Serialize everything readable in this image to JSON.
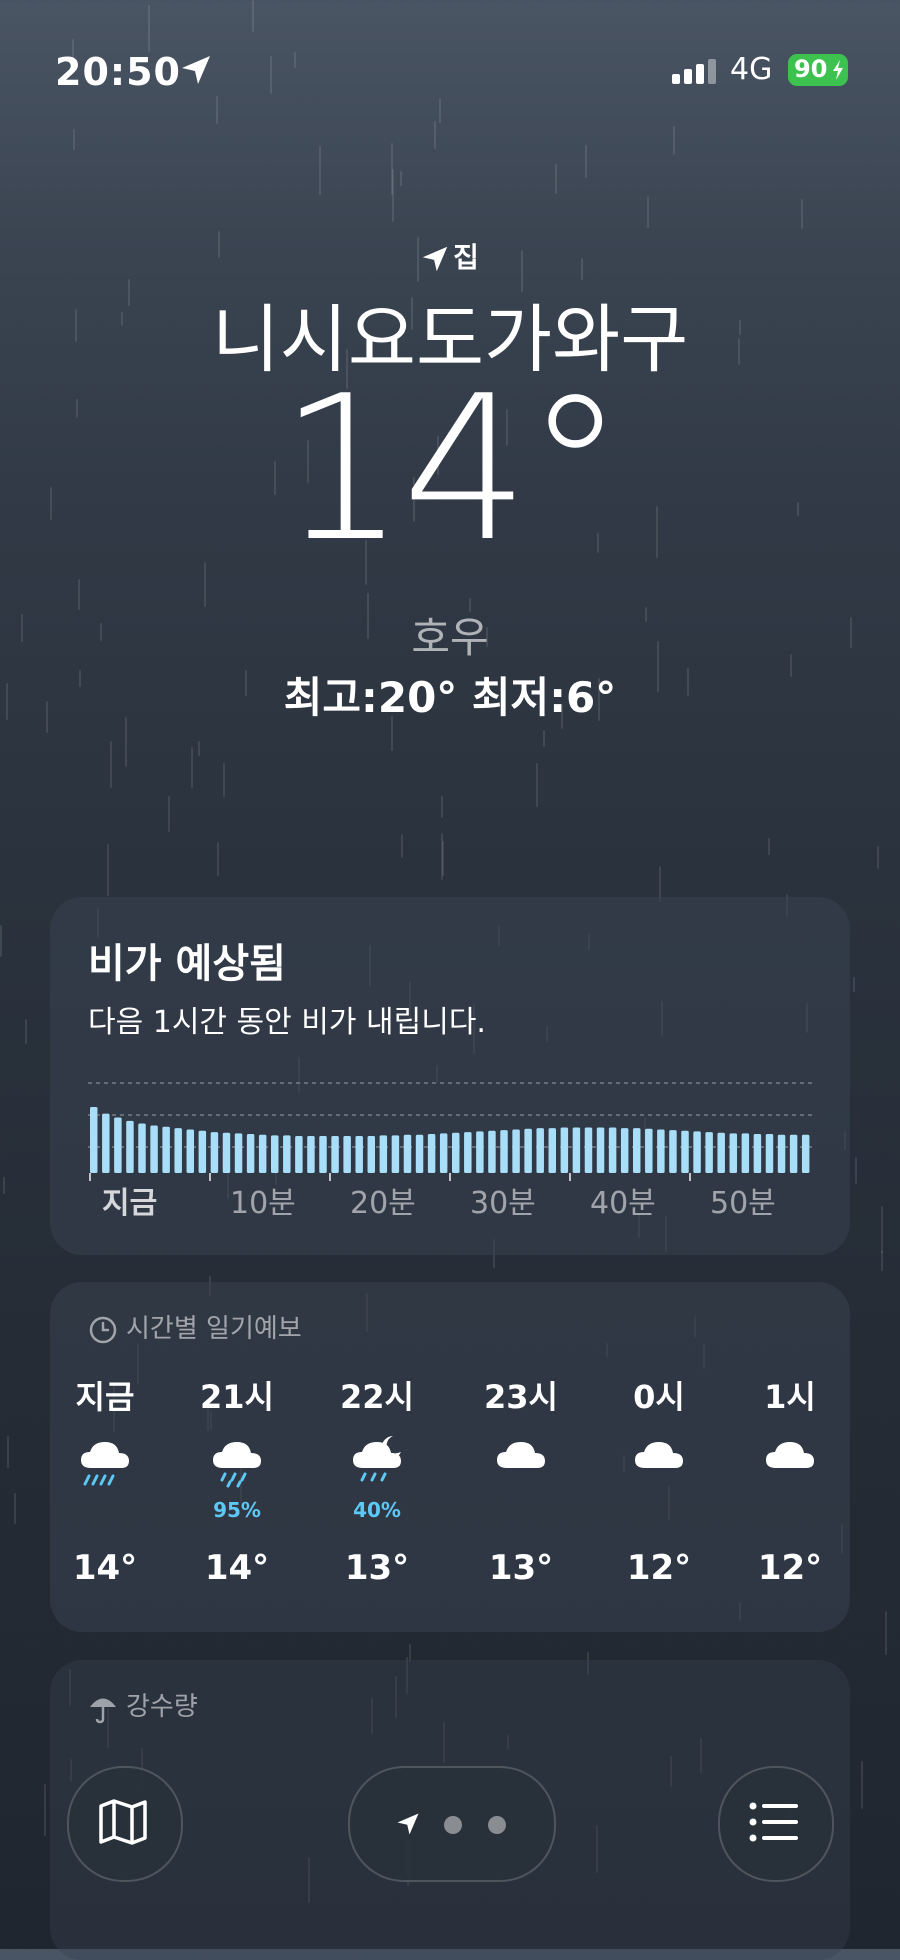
{
  "status_bar": {
    "time": "20:50",
    "network": "4G",
    "battery": "90"
  },
  "location": {
    "label": "집",
    "city": "니시요도가와구"
  },
  "current": {
    "temperature": "14°",
    "condition": "호우",
    "high_low": "최고:20°  최저:6°"
  },
  "rain_card": {
    "title": "비가 예상됨",
    "subtitle": "다음 1시간 동안 비가 내립니다.",
    "chart_data": {
      "type": "bar",
      "tick_labels": [
        "지금",
        "10분",
        "20분",
        "30분",
        "40분",
        "50분"
      ],
      "values": [
        1.0,
        0.9,
        0.84,
        0.79,
        0.75,
        0.72,
        0.7,
        0.68,
        0.66,
        0.64,
        0.62,
        0.61,
        0.6,
        0.59,
        0.58,
        0.57,
        0.57,
        0.56,
        0.56,
        0.56,
        0.56,
        0.56,
        0.56,
        0.56,
        0.57,
        0.57,
        0.58,
        0.58,
        0.59,
        0.6,
        0.61,
        0.62,
        0.63,
        0.64,
        0.65,
        0.66,
        0.67,
        0.68,
        0.68,
        0.69,
        0.69,
        0.69,
        0.69,
        0.69,
        0.68,
        0.68,
        0.67,
        0.66,
        0.65,
        0.64,
        0.63,
        0.62,
        0.61,
        0.6,
        0.6,
        0.59,
        0.59,
        0.58,
        0.58,
        0.58
      ],
      "bar_color": "#a8def7"
    }
  },
  "hourly_card": {
    "title": "시간별 일기예보",
    "hours": [
      {
        "label": "지금",
        "icon": "heavy-rain-icon",
        "pct": "",
        "temp": "14°"
      },
      {
        "label": "21시",
        "icon": "rain-icon",
        "pct": "95%",
        "temp": "14°"
      },
      {
        "label": "22시",
        "icon": "night-rain-icon",
        "pct": "40%",
        "temp": "13°"
      },
      {
        "label": "23시",
        "icon": "cloud-icon",
        "pct": "",
        "temp": "13°"
      },
      {
        "label": "0시",
        "icon": "cloud-icon",
        "pct": "",
        "temp": "12°"
      },
      {
        "label": "1시",
        "icon": "cloud-icon",
        "pct": "",
        "temp": "12°"
      }
    ]
  },
  "precip_card": {
    "title": "강수량"
  },
  "colors": {
    "accent_rain": "#5cc8f5",
    "battery": "#3ec24f"
  }
}
